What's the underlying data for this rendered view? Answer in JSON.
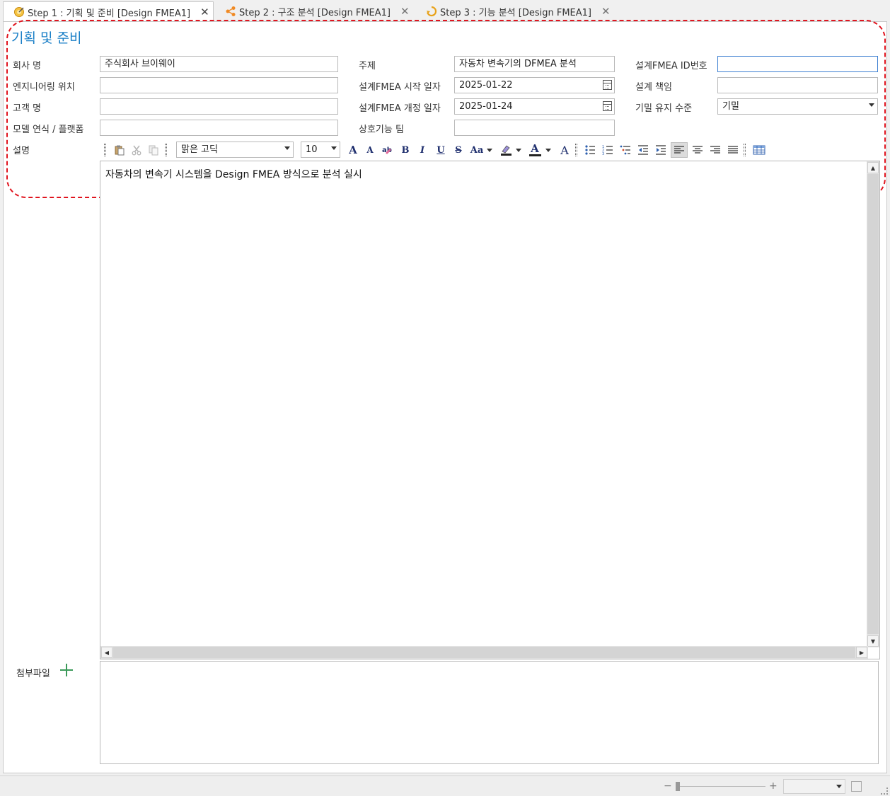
{
  "tabs": [
    {
      "label": "Step 1 : 기획 및 준비 [Design FMEA1]",
      "close": "✕",
      "active": true
    },
    {
      "label": "Step 2 : 구조 분석 [Design FMEA1]",
      "close": "✕",
      "active": false
    },
    {
      "label": "Step 3 : 기능 분석 [Design FMEA1]",
      "close": "✕",
      "active": false
    }
  ],
  "section_title": "기획 및 준비",
  "form": {
    "company": {
      "label": "회사 명",
      "value": "주식회사 브이웨이"
    },
    "engineering_location": {
      "label": "엔지니어링 위치",
      "value": ""
    },
    "customer": {
      "label": "고객 명",
      "value": ""
    },
    "model_year": {
      "label": "모델 연식 / 플랫폼",
      "value": ""
    },
    "subject": {
      "label": "주제",
      "value": "자동차 변속기의 DFMEA 분석"
    },
    "start_date": {
      "label": "설계FMEA 시작 일자",
      "value": "2025-01-22"
    },
    "revision_date": {
      "label": "설계FMEA 개정 일자",
      "value": "2025-01-24"
    },
    "cross_team": {
      "label": "상호기능 팀",
      "value": ""
    },
    "fmea_id": {
      "label": "설계FMEA ID번호",
      "value": ""
    },
    "responsibility": {
      "label": "설계 책임",
      "value": ""
    },
    "confidentiality": {
      "label": "기밀 유지 수준",
      "value": "기밀"
    },
    "description": {
      "label": "설명",
      "value": "자동차의 변속기 시스템을 Design FMEA 방식으로 분석 실시"
    }
  },
  "toolbar": {
    "font_name": "맑은 고딕",
    "font_size": "10",
    "bold": "B",
    "italic": "I",
    "underline": "U",
    "strike": "S",
    "case": "Aa",
    "font_color": "A",
    "grow_font": "A",
    "shrink_font": "A",
    "clear_format": "A"
  },
  "attachments": {
    "label": "첨부파일"
  },
  "colors": {
    "accent": "#1a7fc7",
    "highlight_border": "#e0141e",
    "add": "#3c9a5a"
  },
  "status": {
    "zoom_minus": "−",
    "zoom_plus": "+"
  }
}
